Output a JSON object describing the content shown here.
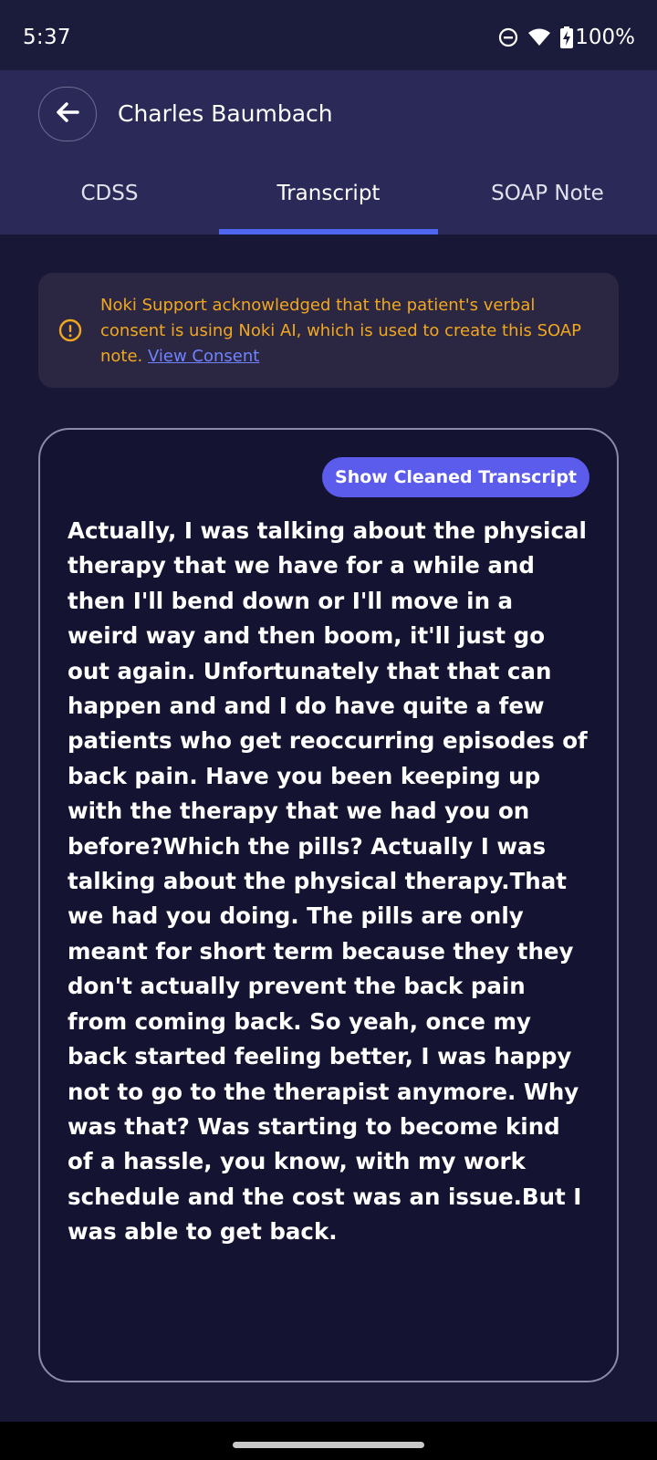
{
  "status_bar": {
    "time": "5:37",
    "battery": "100%",
    "icons": [
      "do-not-disturb-icon",
      "wifi-icon",
      "battery-charging-icon"
    ]
  },
  "header": {
    "title": "Charles Baumbach",
    "back_icon": "arrow-left-icon"
  },
  "tabs": [
    {
      "label": "CDSS",
      "active": false
    },
    {
      "label": "Transcript",
      "active": true
    },
    {
      "label": "SOAP Note",
      "active": false
    }
  ],
  "consent": {
    "icon": "info-circle-icon",
    "text": "Noki Support acknowledged that the patient's verbal consent is using Noki AI, which is used to create this SOAP note. ",
    "link_label": "View Consent"
  },
  "transcript": {
    "button_label": "Show Cleaned Transcript",
    "text": "Actually, I was talking about the physical therapy that we have for a while and then I'll bend down or I'll move in a weird way and then boom, it'll just go out again. Unfortunately that that can happen and and I do have quite a few patients who get reoccurring episodes of back pain. Have you been keeping up with the therapy that we had you on before?Which the pills? Actually I was talking about the physical therapy.That we had you doing. The pills are only meant for short term because they they don't actually prevent the back pain from coming back. So yeah, once my back started feeling better, I was happy not to go to the therapist anymore. Why was that? Was starting to become kind of a hassle, you know, with my work schedule and the cost was an issue.But I was able to get back."
  },
  "colors": {
    "background": "#181836",
    "header": "#2a2958",
    "tab_indicator": "#4f66f0",
    "consent_text": "#f1a81f",
    "consent_link": "#6f83ff",
    "primary_button": "#5b5cec"
  }
}
